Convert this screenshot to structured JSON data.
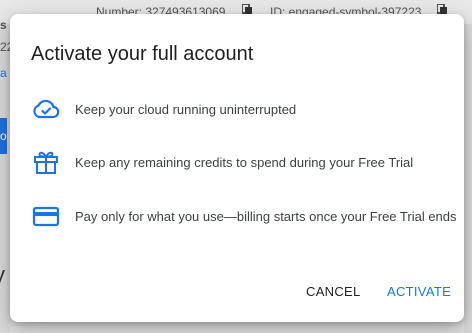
{
  "background": {
    "number_label": "Number: 327493613069",
    "id_label": "ID: engaged-symbol-397223",
    "left_fragments": [
      "s",
      "22",
      "a",
      "o",
      "y"
    ]
  },
  "dialog": {
    "title": "Activate your full account",
    "features": [
      {
        "icon": "cloud-check-icon",
        "text": "Keep your cloud running uninterrupted"
      },
      {
        "icon": "gift-icon",
        "text": "Keep any remaining credits to spend during your Free Trial"
      },
      {
        "icon": "credit-card-icon",
        "text": "Pay only for what you use—billing starts once your Free Trial ends"
      }
    ],
    "cancel_label": "CANCEL",
    "activate_label": "ACTIVATE"
  },
  "colors": {
    "accent": "#1a73e8",
    "title_text": "#202124",
    "body_text": "#3c4043"
  }
}
